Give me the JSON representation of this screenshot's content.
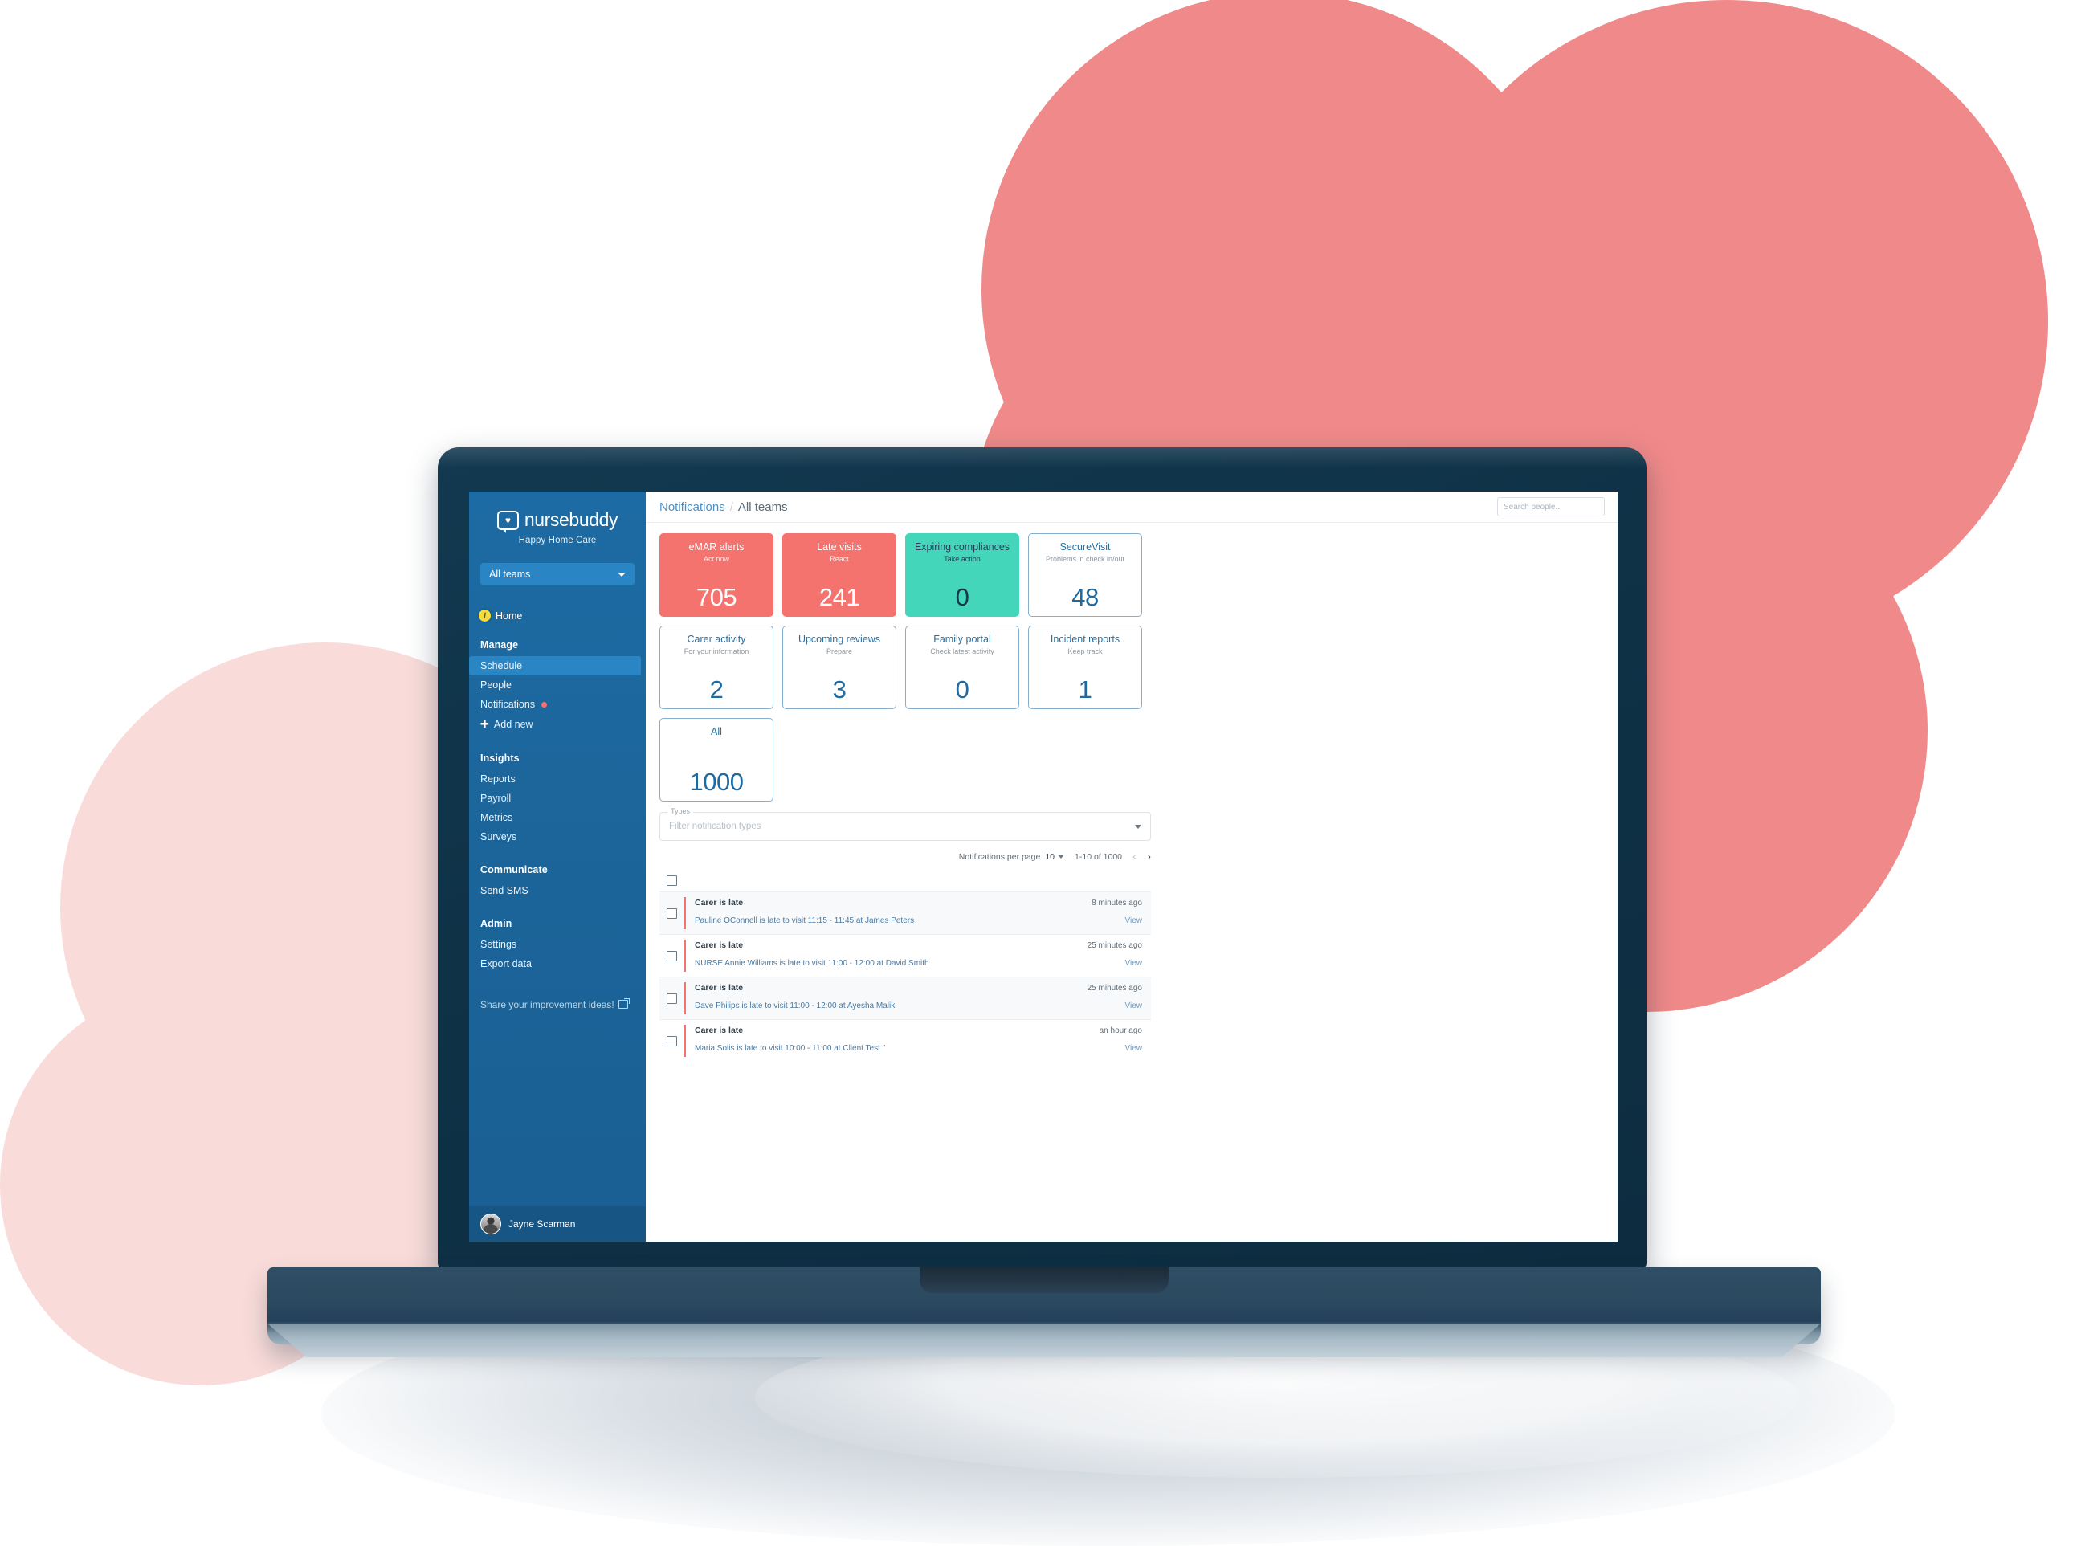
{
  "colors": {
    "coral": "#F4736F",
    "teal": "#44D6BA",
    "sidebar_blue": "#1B6499",
    "accent_blue": "#2B6F9E",
    "bg_coral_blob": "#F08A8A",
    "bg_pink_blob": "#F9DCD9",
    "laptop_bezel": "#0F3247"
  },
  "sidebar": {
    "brand_name": "nursebuddy",
    "brand_subtitle": "Happy Home Care",
    "team_selector": {
      "value": "All teams"
    },
    "home_label": "Home",
    "groups": [
      {
        "heading": "Manage",
        "items": [
          {
            "label": "Schedule",
            "active": true
          },
          {
            "label": "People",
            "active": false
          },
          {
            "label": "Notifications",
            "active": false,
            "badge": true
          },
          {
            "label": "Add new",
            "active": false,
            "icon": "plus-icon"
          }
        ]
      },
      {
        "heading": "Insights",
        "items": [
          {
            "label": "Reports"
          },
          {
            "label": "Payroll"
          },
          {
            "label": "Metrics"
          },
          {
            "label": "Surveys"
          }
        ]
      },
      {
        "heading": "Communicate",
        "items": [
          {
            "label": "Send SMS"
          }
        ]
      },
      {
        "heading": "Admin",
        "items": [
          {
            "label": "Settings"
          },
          {
            "label": "Export data"
          }
        ]
      }
    ],
    "improvement_link": "Share your improvement ideas!",
    "user": {
      "name": "Jayne Scarman"
    }
  },
  "topbar": {
    "breadcrumb_link": "Notifications",
    "breadcrumb_separator": "/",
    "breadcrumb_current": "All teams",
    "search_placeholder": "Search people..."
  },
  "cards": [
    {
      "title": "eMAR alerts",
      "subtitle": "Act now",
      "value": "705",
      "style": "coral"
    },
    {
      "title": "Late visits",
      "subtitle": "React",
      "value": "241",
      "style": "coral"
    },
    {
      "title": "Expiring compliances",
      "subtitle": "Take action",
      "value": "0",
      "style": "teal"
    },
    {
      "title": "SecureVisit",
      "subtitle": "Problems in check in/out",
      "value": "48",
      "style": "plain"
    },
    {
      "title": "Carer activity",
      "subtitle": "For your information",
      "value": "2",
      "style": "plain"
    },
    {
      "title": "Upcoming reviews",
      "subtitle": "Prepare",
      "value": "3",
      "style": "plain"
    },
    {
      "title": "Family portal",
      "subtitle": "Check latest activity",
      "value": "0",
      "style": "plain"
    },
    {
      "title": "Incident reports",
      "subtitle": "Keep track",
      "value": "1",
      "style": "plain"
    },
    {
      "title": "All",
      "subtitle": "",
      "value": "1000",
      "style": "plain"
    }
  ],
  "filter": {
    "legend": "Types",
    "placeholder": "Filter notification types"
  },
  "pagination": {
    "per_page_label": "Notifications per page",
    "per_page_value": "10",
    "range_label": "1-10 of 1000",
    "prev_icon": "‹",
    "next_icon": "›"
  },
  "notifications": [
    {
      "title": "Carer is late",
      "time": "8 minutes ago",
      "description": "Pauline OConnell is late to visit 11:15 - 11:45 at James Peters",
      "action": "View"
    },
    {
      "title": "Carer is late",
      "time": "25 minutes ago",
      "description": "NURSE Annie Williams is late to visit 11:00 - 12:00 at David Smith",
      "action": "View"
    },
    {
      "title": "Carer is late",
      "time": "25 minutes ago",
      "description": "Dave Philips is late to visit 11:00 - 12:00 at Ayesha Malik",
      "action": "View"
    },
    {
      "title": "Carer is late",
      "time": "an hour ago",
      "description": "Maria Solis is late to visit 10:00 - 11:00 at Client Test \"",
      "action": "View"
    }
  ]
}
